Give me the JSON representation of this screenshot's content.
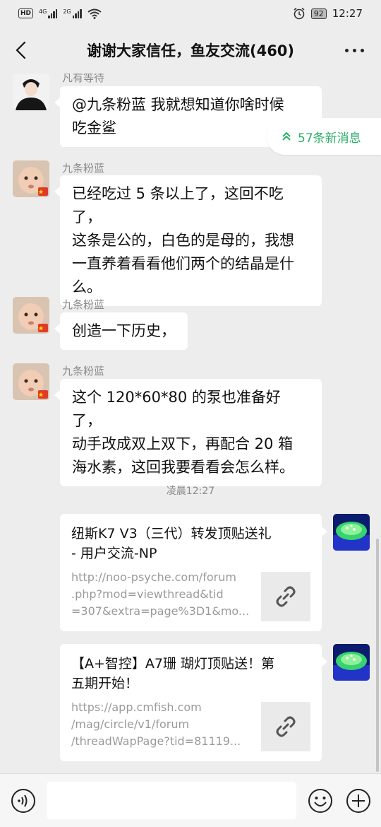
{
  "status_bar": {
    "hd": "HD",
    "net1": "4G",
    "net2": "2G",
    "battery": "92",
    "time": "12:27"
  },
  "header": {
    "title": "谢谢大家信任，鱼友交流(460)"
  },
  "new_messages": {
    "label": "57条新消息"
  },
  "messages": [
    {
      "sender": "凡有等待",
      "lines": [
        "@九条粉蓝  我就想知道你啥时候",
        "吃金鲨"
      ]
    },
    {
      "sender": "九条粉蓝",
      "lines": [
        "已经吃过 5 条以上了，这回不吃了，",
        "这条是公的，白色的是母的，我想",
        "一直养着看看他们两个的结晶是什",
        "么。"
      ]
    },
    {
      "sender": "九条粉蓝",
      "lines": [
        "创造一下历史，"
      ]
    },
    {
      "sender": "九条粉蓝",
      "lines": [
        "这个 120*60*80 的泵也准备好了，",
        "动手改成双上双下，再配合 20 箱",
        "海水素，这回我要看看会怎么样。"
      ]
    }
  ],
  "timestamp": "凌晨12:27",
  "links": [
    {
      "title_lines": [
        "纽斯K7 V3（三代）转发顶贴送礼",
        "- 用户交流-NP"
      ],
      "desc_lines": [
        "http://noo-psyche.com/forum",
        ".php?mod=viewthread&tid",
        "=307&extra=page%3D1&mo..."
      ]
    },
    {
      "title_lines": [
        "【A+智控】A7珊 瑚灯顶贴送！第",
        "五期开始！"
      ],
      "desc_lines": [
        "https://app.cmfish.com",
        "/mag/circle/v1/forum",
        "/threadWapPage?tid=81119..."
      ]
    }
  ],
  "input": {
    "value": ""
  },
  "colors": {
    "accent": "#2aae67",
    "background": "#ededed"
  }
}
